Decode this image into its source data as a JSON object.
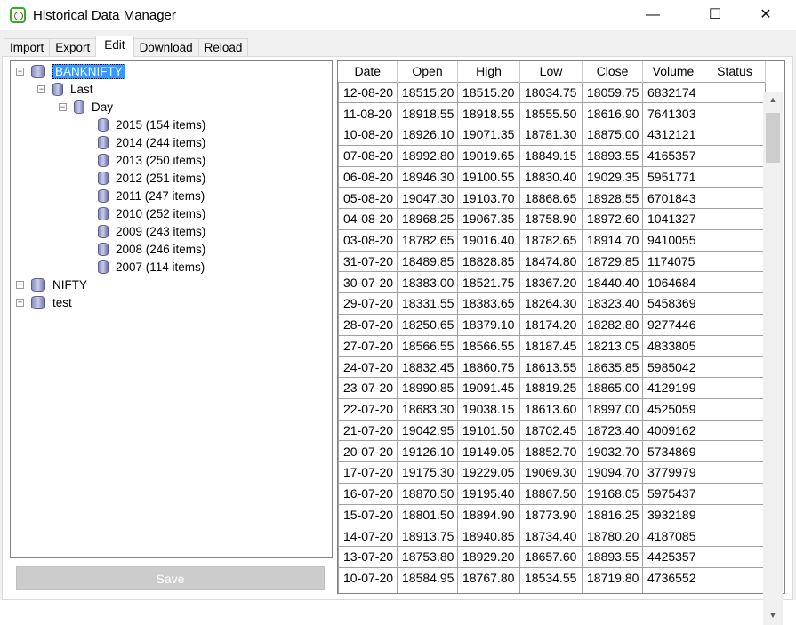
{
  "window": {
    "title": "Historical Data Manager",
    "minimize": "—",
    "maximize": "☐",
    "close": "✕"
  },
  "tabs": [
    "Import",
    "Export",
    "Edit",
    "Download",
    "Reload"
  ],
  "tree": {
    "root": "BANKNIFTY",
    "child": "Last",
    "grandchild": "Day",
    "years": [
      "2015 (154 items)",
      "2014 (244 items)",
      "2013 (250 items)",
      "2012 (251 items)",
      "2011 (247 items)",
      "2010 (252 items)",
      "2009 (243 items)",
      "2008 (246 items)",
      "2007 (114 items)"
    ],
    "others": [
      "NIFTY",
      "test"
    ]
  },
  "save_label": "Save",
  "table": {
    "columns": [
      "Date",
      "Open",
      "High",
      "Low",
      "Close",
      "Volume",
      "Status"
    ],
    "rows": [
      [
        "12-08-20",
        "18515.20",
        "18515.20",
        "18034.75",
        "18059.75",
        "6832174",
        ""
      ],
      [
        "11-08-20",
        "18918.55",
        "18918.55",
        "18555.50",
        "18616.90",
        "7641303",
        ""
      ],
      [
        "10-08-20",
        "18926.10",
        "19071.35",
        "18781.30",
        "18875.00",
        "4312121",
        ""
      ],
      [
        "07-08-20",
        "18992.80",
        "19019.65",
        "18849.15",
        "18893.55",
        "4165357",
        ""
      ],
      [
        "06-08-20",
        "18946.30",
        "19100.55",
        "18830.40",
        "19029.35",
        "5951771",
        ""
      ],
      [
        "05-08-20",
        "19047.30",
        "19103.70",
        "18868.65",
        "18928.55",
        "6701843",
        ""
      ],
      [
        "04-08-20",
        "18968.25",
        "19067.35",
        "18758.90",
        "18972.60",
        "1041327",
        ""
      ],
      [
        "03-08-20",
        "18782.65",
        "19016.40",
        "18782.65",
        "18914.70",
        "9410055",
        ""
      ],
      [
        "31-07-20",
        "18489.85",
        "18828.85",
        "18474.80",
        "18729.85",
        "1174075",
        ""
      ],
      [
        "30-07-20",
        "18383.00",
        "18521.75",
        "18367.20",
        "18440.40",
        "1064684",
        ""
      ],
      [
        "29-07-20",
        "18331.55",
        "18383.65",
        "18264.30",
        "18323.40",
        "5458369",
        ""
      ],
      [
        "28-07-20",
        "18250.65",
        "18379.10",
        "18174.20",
        "18282.80",
        "9277446",
        ""
      ],
      [
        "27-07-20",
        "18566.55",
        "18566.55",
        "18187.45",
        "18213.05",
        "4833805",
        ""
      ],
      [
        "24-07-20",
        "18832.45",
        "18860.75",
        "18613.55",
        "18635.85",
        "5985042",
        ""
      ],
      [
        "23-07-20",
        "18990.85",
        "19091.45",
        "18819.25",
        "18865.00",
        "4129199",
        ""
      ],
      [
        "22-07-20",
        "18683.30",
        "19038.15",
        "18613.60",
        "18997.00",
        "4525059",
        ""
      ],
      [
        "21-07-20",
        "19042.95",
        "19101.50",
        "18702.45",
        "18723.40",
        "4009162",
        ""
      ],
      [
        "20-07-20",
        "19126.10",
        "19149.05",
        "18852.70",
        "19032.70",
        "5734869",
        ""
      ],
      [
        "17-07-20",
        "19175.30",
        "19229.05",
        "19069.30",
        "19094.70",
        "3779979",
        ""
      ],
      [
        "16-07-20",
        "18870.50",
        "19195.40",
        "18867.50",
        "19168.05",
        "5975437",
        ""
      ],
      [
        "15-07-20",
        "18801.50",
        "18894.90",
        "18773.90",
        "18816.25",
        "3932189",
        ""
      ],
      [
        "14-07-20",
        "18913.75",
        "18940.85",
        "18734.40",
        "18780.20",
        "4187085",
        ""
      ],
      [
        "13-07-20",
        "18753.80",
        "18929.20",
        "18657.60",
        "18893.55",
        "4425357",
        ""
      ],
      [
        "10-07-20",
        "18584.95",
        "18767.80",
        "18534.55",
        "18719.80",
        "4736552",
        ""
      ]
    ]
  }
}
